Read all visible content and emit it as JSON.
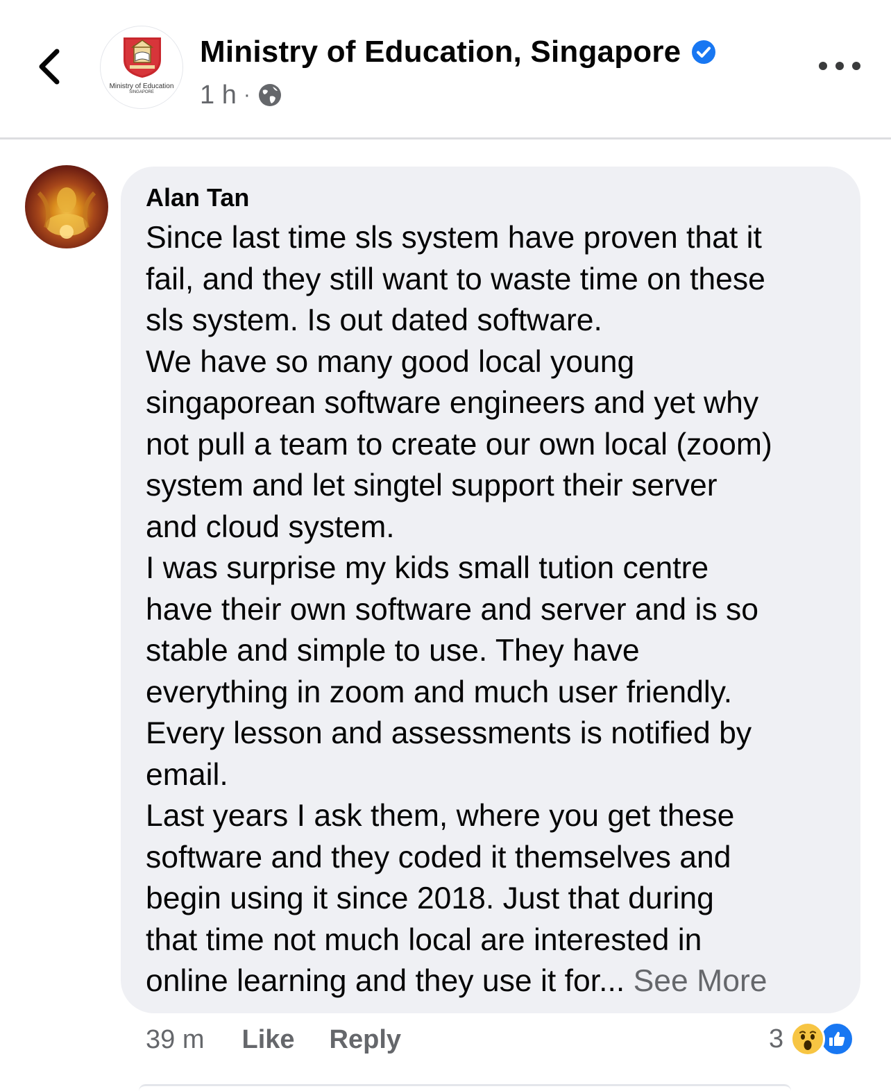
{
  "header": {
    "back_icon": "chevron-left-icon",
    "page_name": "Ministry of Education, Singapore",
    "verified_icon": "verified-badge-icon",
    "time": "1 h",
    "separator": "·",
    "privacy_icon": "globe-icon",
    "more_icon": "more-dots-icon",
    "logo_text": "Ministry of Education",
    "logo_subtext": "SINGAPORE"
  },
  "comment": {
    "author": "Alan Tan",
    "lines": [
      "Since last time sls system have proven that it",
      "fail, and they still want to waste time on these",
      "sls system. Is out dated software.",
      "We have so many good local young",
      "singaporean software engineers and yet why",
      "not pull a team to create our own local (zoom)",
      "system and let singtel support their server",
      "and cloud system.",
      "I was surprise my kids small tution centre",
      "have their own software and server and is so",
      "stable and simple to use. They have",
      "everything in zoom and much user friendly.",
      "Every lesson and assessments is notified by",
      "email.",
      "Last years I ask them, where you get these",
      "software and they coded it themselves and",
      "begin using it since 2018. Just that during",
      "that time not much local are interested in",
      "online learning and they use it for..."
    ],
    "see_more": "See More",
    "time": "39 m",
    "like_label": "Like",
    "reply_label": "Reply",
    "reaction_count": "3",
    "reaction_icons": [
      "wow-reaction-icon",
      "like-reaction-icon"
    ]
  },
  "colors": {
    "primary_text": "#050505",
    "secondary_text": "#65676b",
    "bubble_bg": "#eff0f4",
    "facebook_blue": "#1877f2",
    "verified_blue": "#1877f2",
    "logo_red": "#c8272d"
  }
}
